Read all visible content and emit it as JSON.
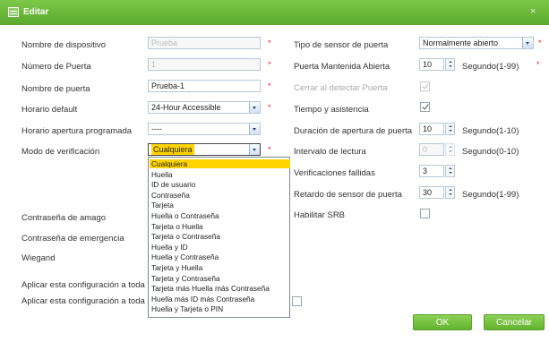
{
  "window": {
    "title": "Editar",
    "close_glyph": "×"
  },
  "left": {
    "device_name": {
      "label": "Nombre de dispositivo",
      "value": "Prueba",
      "required": "*"
    },
    "door_number": {
      "label": "Número de Puerta",
      "value": "1",
      "required": "*"
    },
    "door_name": {
      "label": "Nombre de puerta",
      "value": "Prueba-1",
      "required": "*"
    },
    "default_schedule": {
      "label": "Horario default",
      "value": "24-Hour Accessible",
      "required": "*"
    },
    "scheduled_open": {
      "label": "Horario apertura programada",
      "value": "----"
    },
    "verify_mode": {
      "label": "Modo de verificación",
      "value": "Cualquiera",
      "required": "*"
    },
    "duress_password": {
      "label": "Contraseña de amago"
    },
    "emergency_password": {
      "label": "Contraseña de emergencia"
    },
    "wiegand": {
      "label": "Wiegand"
    },
    "apply_1": {
      "label": "Aplicar esta configuración a toda"
    },
    "apply_2": {
      "label": "Aplicar esta configuración a toda"
    }
  },
  "right": {
    "sensor_type": {
      "label": "Tipo de sensor de puerta",
      "value": "Normalmente abierto",
      "required": "*"
    },
    "held_open": {
      "label": "Puerta Mantenida Abierta",
      "value": "10",
      "unit": "Segundo(1-99)",
      "required": "*"
    },
    "close_on_detect": {
      "label": "Cerrar al detectar Puerta",
      "checked": true
    },
    "time_attendance": {
      "label": "Tiempo y asistencia",
      "checked": true
    },
    "open_duration": {
      "label": "Duración de apertura de puerta",
      "value": "10",
      "unit": "Segundo(1-10)"
    },
    "read_interval": {
      "label": "Intervalo de lectura",
      "value": "0",
      "unit": "Segundo(0-10)"
    },
    "failed_attempts": {
      "label": "Verificaciones fallidas",
      "value": "3"
    },
    "sensor_delay": {
      "label": "Retardo de sensor de puerta",
      "value": "30",
      "unit": "Segundo(1-99)"
    },
    "enable_srb": {
      "label": "Habilitar SRB",
      "checked": false
    }
  },
  "verify_options": [
    "Cualquiera",
    "Huella",
    "ID de usuario",
    "Contraseña",
    "Tarjeta",
    "Huella o Contraseña",
    "Tarjeta o Huella",
    "Tarjeta o Contraseña",
    "Huella y ID",
    "Huella y Contraseña",
    "Tarjeta y Huella",
    "Tarjeta y Contraseña",
    "Tarjeta más Huella más Contraseña",
    "Huella más ID más Contraseña",
    "Huella y Tarjeta o PIN"
  ],
  "buttons": {
    "ok": "OK",
    "cancel": "Cancelar"
  },
  "colors": {
    "title_bar": "#6cba3c",
    "selected": "#ffd400",
    "button": "#76c244",
    "required": "#e23333"
  }
}
